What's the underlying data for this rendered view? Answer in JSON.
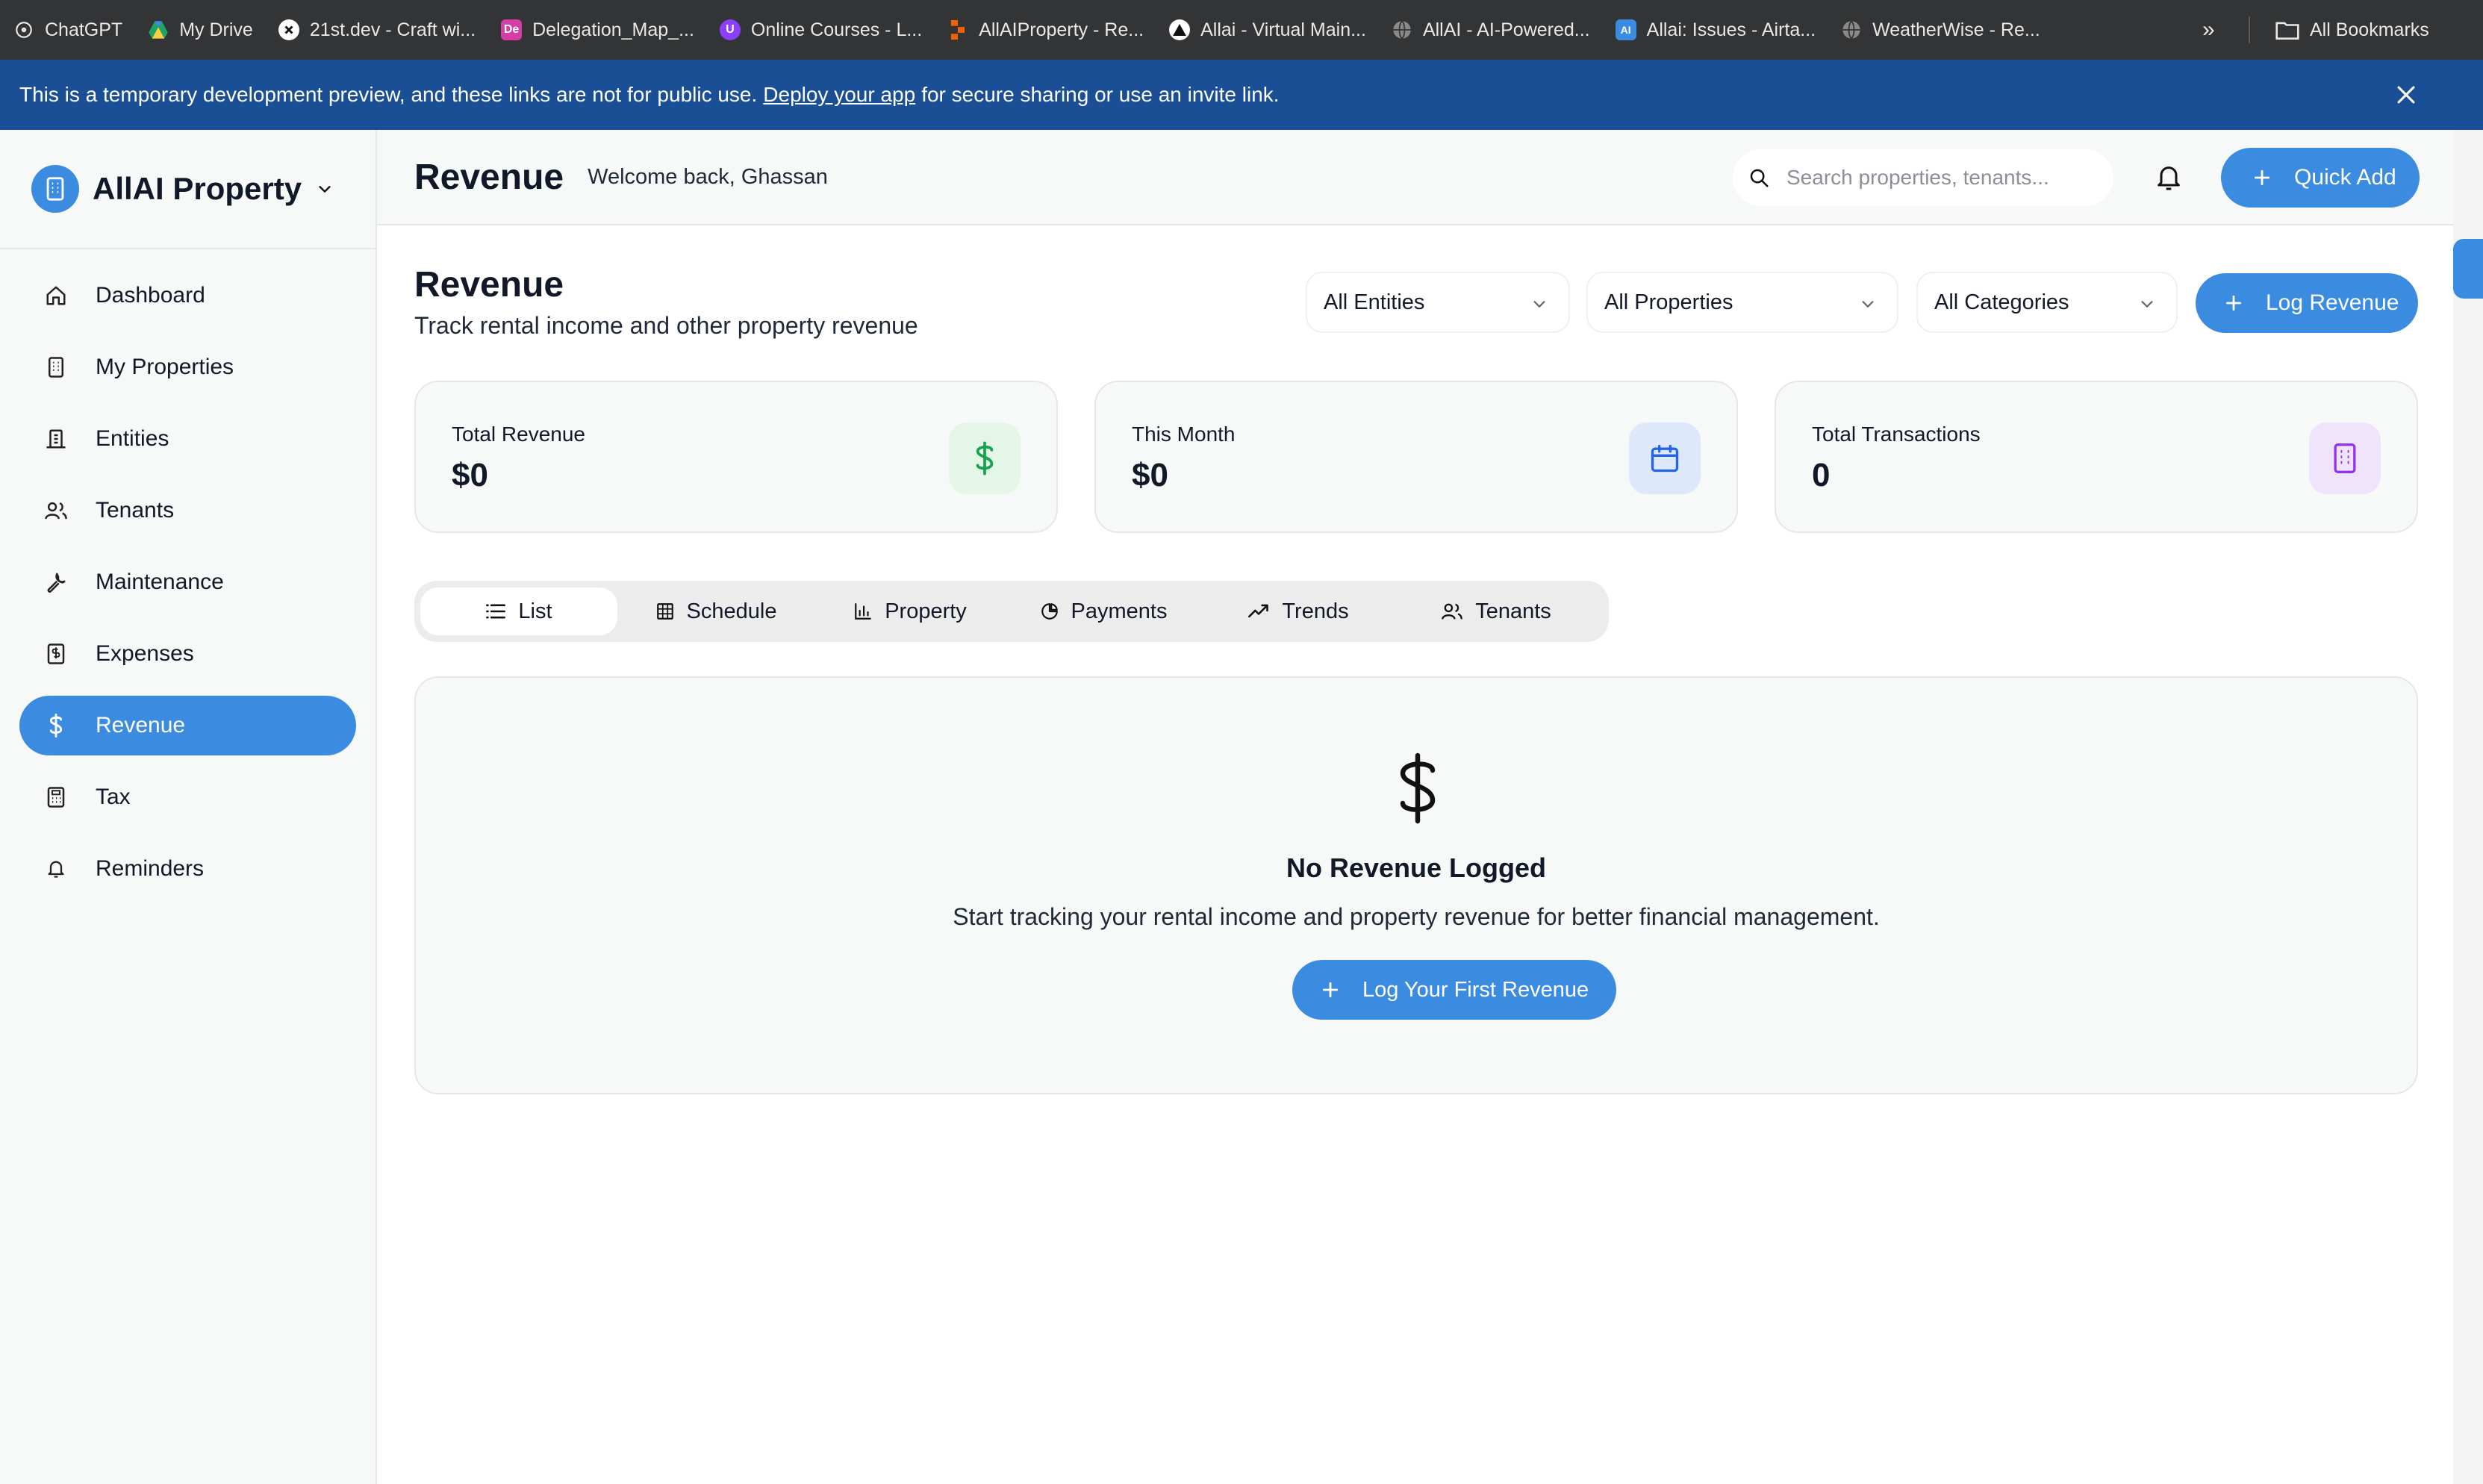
{
  "browser": {
    "bookmarks": [
      {
        "label": "ChatGPT",
        "icon": "chatgpt-icon",
        "color": "#333436"
      },
      {
        "label": "My Drive",
        "icon": "google-drive-icon",
        "color": "#1fa463"
      },
      {
        "label": "21st.dev - Craft wi...",
        "icon": "21st-icon",
        "color": "#111111"
      },
      {
        "label": "Delegation_Map_...",
        "icon": "de-icon",
        "color": "#d63ea7"
      },
      {
        "label": "Online Courses - L...",
        "icon": "udemy-icon",
        "color": "#8a3ffc"
      },
      {
        "label": "AllAIProperty - Re...",
        "icon": "replit-icon",
        "color": "#f26207"
      },
      {
        "label": "Allai - Virtual Main...",
        "icon": "triangle-icon",
        "color": "#111111"
      },
      {
        "label": "AllAI - AI-Powered...",
        "icon": "globe-icon",
        "color": "#888888"
      },
      {
        "label": "Allai: Issues - Airta...",
        "icon": "ai-icon",
        "color": "#3b8be0"
      },
      {
        "label": "WeatherWise - Re...",
        "icon": "globe-icon",
        "color": "#888888"
      }
    ],
    "more_label": "»",
    "all_bookmarks_label": "All Bookmarks"
  },
  "banner": {
    "text_before": "This is a temporary development preview, and these links are not for public use.",
    "link": "Deploy your app",
    "text_after": "for secure sharing or use an invite link."
  },
  "sidebar": {
    "brand": "AllAI Property",
    "items": [
      {
        "label": "Dashboard",
        "icon": "home-icon",
        "active": false
      },
      {
        "label": "My Properties",
        "icon": "building-icon",
        "active": false
      },
      {
        "label": "Entities",
        "icon": "entities-icon",
        "active": false
      },
      {
        "label": "Tenants",
        "icon": "users-icon",
        "active": false
      },
      {
        "label": "Maintenance",
        "icon": "wrench-icon",
        "active": false
      },
      {
        "label": "Expenses",
        "icon": "receipt-icon",
        "active": false
      },
      {
        "label": "Revenue",
        "icon": "dollar-icon",
        "active": true
      },
      {
        "label": "Tax",
        "icon": "calculator-icon",
        "active": false
      },
      {
        "label": "Reminders",
        "icon": "bell-icon",
        "active": false
      }
    ]
  },
  "header": {
    "title": "Revenue",
    "welcome": "Welcome back, Ghassan",
    "search_placeholder": "Search properties, tenants...",
    "quick_add": "Quick Add"
  },
  "page": {
    "title": "Revenue",
    "subtitle": "Track rental income and other property revenue",
    "filters": {
      "entities": "All Entities",
      "properties": "All Properties",
      "categories": "All Categories"
    },
    "log_button": "Log Revenue"
  },
  "stats": [
    {
      "label": "Total Revenue",
      "value": "$0",
      "icon": "dollar-icon",
      "color": "#16a34a",
      "bg": "#e3f6e8"
    },
    {
      "label": "This Month",
      "value": "$0",
      "icon": "calendar-icon",
      "color": "#2563eb",
      "bg": "#dde9fb"
    },
    {
      "label": "Total Transactions",
      "value": "0",
      "icon": "building-icon",
      "color": "#9333ea",
      "bg": "#efe4fb"
    }
  ],
  "tabs": [
    {
      "label": "List",
      "icon": "list-icon",
      "active": true
    },
    {
      "label": "Schedule",
      "icon": "grid-icon",
      "active": false
    },
    {
      "label": "Property",
      "icon": "bar-chart-icon",
      "active": false
    },
    {
      "label": "Payments",
      "icon": "pie-chart-icon",
      "active": false
    },
    {
      "label": "Trends",
      "icon": "trending-up-icon",
      "active": false
    },
    {
      "label": "Tenants",
      "icon": "users-icon",
      "active": false
    }
  ],
  "empty_state": {
    "title": "No Revenue Logged",
    "text": "Start tracking your rental income and property revenue for better financial management.",
    "button": "Log Your First Revenue"
  },
  "colors": {
    "accent": "#3b8be0",
    "banner": "#1a4f96",
    "bookmarks_bar": "#333436"
  }
}
